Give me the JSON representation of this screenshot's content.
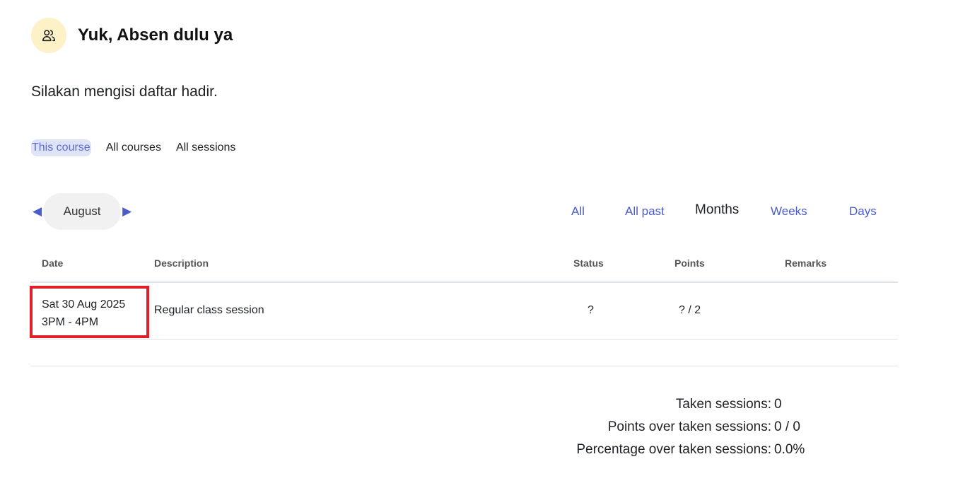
{
  "header": {
    "icon": "users-icon",
    "title": "Yuk, Absen dulu ya"
  },
  "intro": "Silakan mengisi daftar hadir.",
  "course_filter": {
    "tabs": [
      {
        "label": "This course",
        "active": true
      },
      {
        "label": "All courses",
        "active": false
      },
      {
        "label": "All sessions",
        "active": false
      }
    ]
  },
  "month_nav": {
    "prev_icon": "arrow-left-icon",
    "month": "August",
    "next_icon": "arrow-right-icon"
  },
  "view_tabs": {
    "all": "All",
    "all_past": "All past",
    "months": "Months",
    "weeks": "Weeks",
    "days": "Days",
    "current": "Months"
  },
  "table": {
    "headers": {
      "date": "Date",
      "description": "Description",
      "status": "Status",
      "points": "Points",
      "remarks": "Remarks"
    },
    "rows": [
      {
        "date": "Sat 30 Aug 2025",
        "time": "3PM - 4PM",
        "description": "Regular class session",
        "status": "?",
        "points": "? / 2",
        "remarks": ""
      }
    ]
  },
  "summary": {
    "taken_label": "Taken sessions:",
    "taken_value": "0",
    "points_label": "Points over taken sessions:",
    "points_value": "0 / 0",
    "pct_label": "Percentage over taken sessions:",
    "pct_value": "0.0%"
  },
  "colors": {
    "accent": "#4a5bcc",
    "highlight_border": "#e02028",
    "icon_bg": "#fdf1c7"
  }
}
